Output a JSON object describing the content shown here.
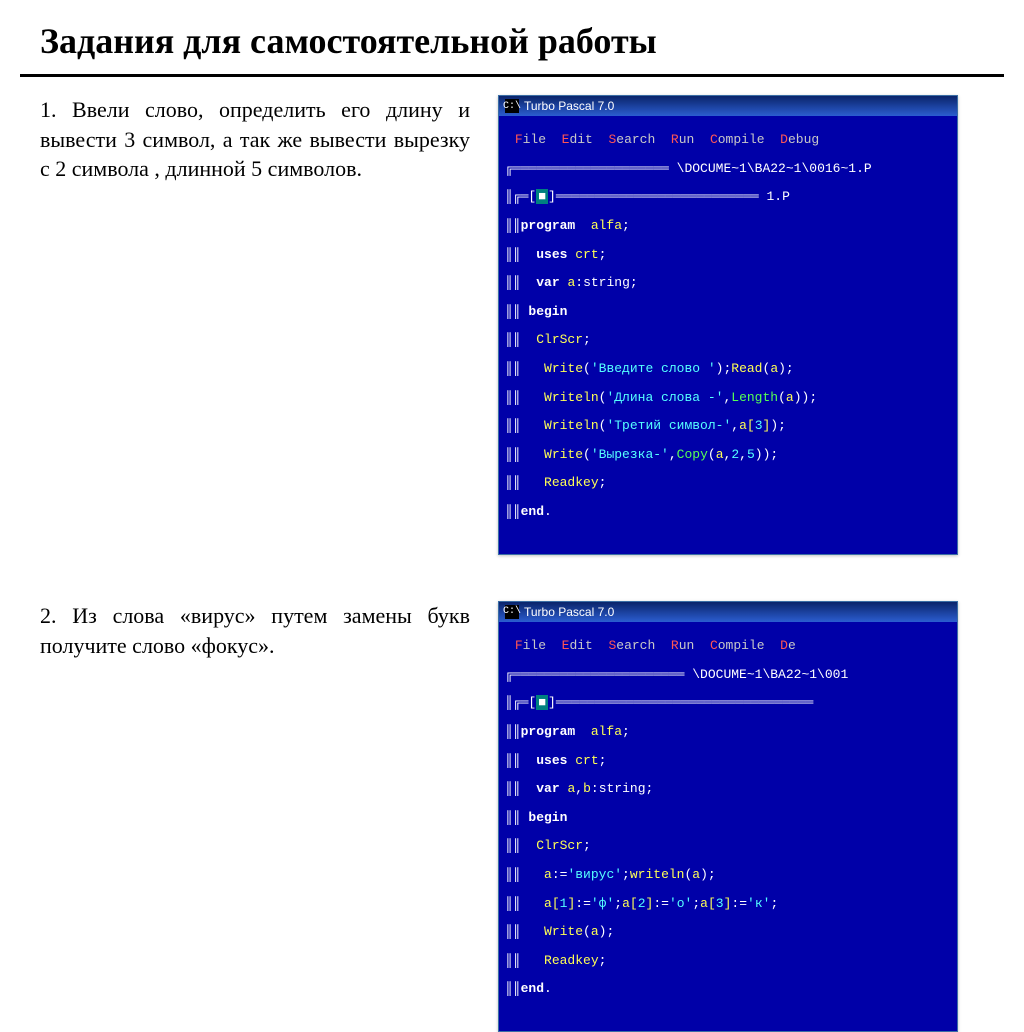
{
  "title": "Задания для самостоятельной работы",
  "task1": "1. Ввели слово, определить его длину и вывести 3 символ, а так же вывести вырезку с 2 символа , длинной 5 символов.",
  "task2": "2. Из слова «вирус» путем замены букв получите слово «фокус».",
  "tp": {
    "title": "Turbo Pascal 7.0",
    "menu": [
      {
        "hot": "F",
        "rest": "ile"
      },
      {
        "hot": "E",
        "rest": "dit"
      },
      {
        "hot": "S",
        "rest": "earch"
      },
      {
        "hot": "R",
        "rest": "un"
      },
      {
        "hot": "C",
        "rest": "ompile"
      },
      {
        "hot": "D",
        "rest": "ebug"
      }
    ],
    "menu2": [
      {
        "hot": "F",
        "rest": "ile"
      },
      {
        "hot": "E",
        "rest": "dit"
      },
      {
        "hot": "S",
        "rest": "earch"
      },
      {
        "hot": "R",
        "rest": "un"
      },
      {
        "hot": "C",
        "rest": "ompile"
      },
      {
        "hot": "D",
        "rest": "e"
      }
    ],
    "path1": "\\DOCUME~1\\BA22~1\\0016~1.P",
    "path2": "\\DOCUME~1\\BA22~1\\001",
    "ftag1": "1.P",
    "code1": {
      "l1_a": "program",
      "l1_b": "alfa",
      "l2_a": "uses",
      "l2_b": "crt",
      "l3_a": "var",
      "l3_b": "a",
      "l3_c": "string",
      "l4": "begin",
      "l5": "ClrScr",
      "l6_a": "Write",
      "l6_b": "'Введите слово '",
      "l6_c": "Read",
      "l6_d": "a",
      "l7_a": "Writeln",
      "l7_b": "'Длина слова -'",
      "l7_c": "Length",
      "l7_d": "a",
      "l8_a": "Writeln",
      "l8_b": "'Третий символ-'",
      "l8_c": "a",
      "l8_d": "3",
      "l9_a": "Write",
      "l9_b": "'Вырезка-'",
      "l9_c": "Copy",
      "l9_d": "a",
      "l9_e": "2",
      "l9_f": "5",
      "l10": "Readkey",
      "l11": "end"
    },
    "code2": {
      "l1_a": "program",
      "l1_b": "alfa",
      "l2_a": "uses",
      "l2_b": "crt",
      "l3_a": "var",
      "l3_b": "a",
      "l3_c": "b",
      "l3_d": "string",
      "l4": "begin",
      "l5": "ClrScr",
      "l6_a": "a",
      "l6_b": "'вирус'",
      "l6_c": "writeln",
      "l6_d": "a",
      "l7_a": "a",
      "l7_b": "1",
      "l7_c": "'ф'",
      "l7_d": "a",
      "l7_e": "2",
      "l7_f": "'о'",
      "l7_g": "a",
      "l7_h": "3",
      "l7_i": "'к'",
      "l8_a": "Write",
      "l8_b": "a",
      "l9": "Readkey",
      "l10": "end"
    }
  }
}
